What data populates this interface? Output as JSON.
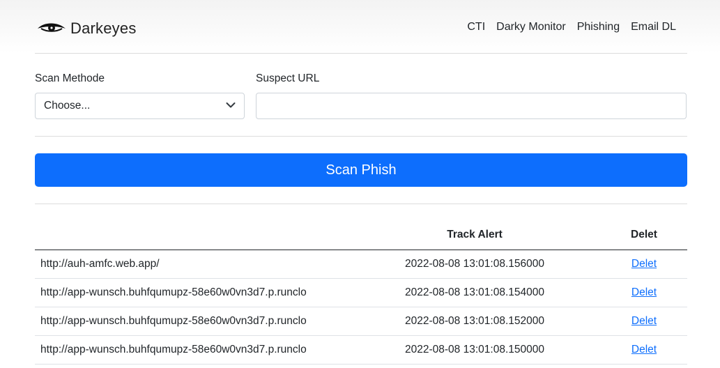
{
  "header": {
    "brand": "Darkeyes",
    "nav": [
      "CTI",
      "Darky Monitor",
      "Phishing",
      "Email DL"
    ]
  },
  "form": {
    "method_label": "Scan Methode",
    "method_value": "Choose...",
    "url_label": "Suspect URL",
    "url_value": "",
    "scan_button": "Scan Phish"
  },
  "table": {
    "headers": [
      "",
      "Track Alert",
      "Delet"
    ],
    "rows": [
      {
        "url": "http://auh-amfc.web.app/",
        "time": "2022-08-08 13:01:08.156000",
        "action": "Delet"
      },
      {
        "url": "http://app-wunsch.buhfqumupz-58e60w0vn3d7.p.runclo",
        "time": "2022-08-08 13:01:08.154000",
        "action": "Delet"
      },
      {
        "url": "http://app-wunsch.buhfqumupz-58e60w0vn3d7.p.runclo",
        "time": "2022-08-08 13:01:08.152000",
        "action": "Delet"
      },
      {
        "url": "http://app-wunsch.buhfqumupz-58e60w0vn3d7.p.runclo",
        "time": "2022-08-08 13:01:08.150000",
        "action": "Delet"
      }
    ]
  },
  "colors": {
    "primary": "#0d6efd",
    "text": "#212529",
    "border": "#ced4da"
  }
}
